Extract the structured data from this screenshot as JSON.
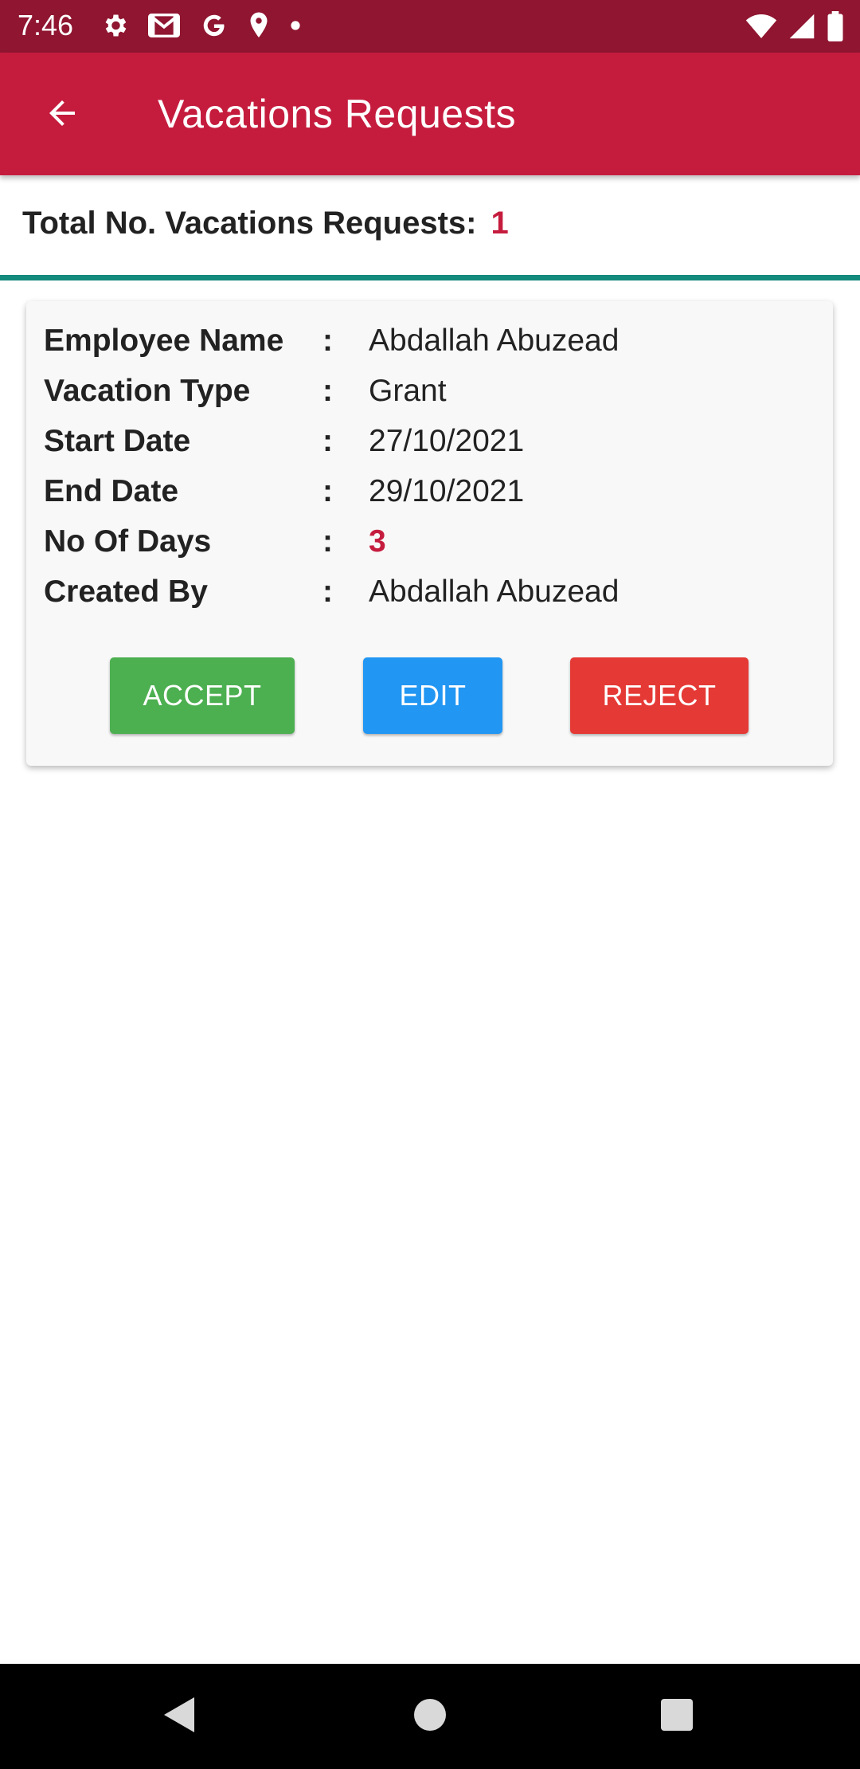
{
  "status_bar": {
    "time": "7:46",
    "icons_left": [
      "settings-icon",
      "gmail-icon",
      "google-icon",
      "location-icon",
      "dot-icon"
    ],
    "icons_right": [
      "wifi-icon",
      "signal-icon",
      "battery-icon"
    ]
  },
  "app_bar": {
    "title": "Vacations Requests",
    "back_icon": "arrow-back-icon",
    "color": "#c51c3e"
  },
  "summary": {
    "label": "Total No. Vacations Requests:",
    "count": "1"
  },
  "requests": [
    {
      "fields": [
        {
          "label": "Employee Name",
          "colon": ":",
          "value": "Abdallah Abuzead"
        },
        {
          "label": "Vacation Type",
          "colon": ":",
          "value": "Grant"
        },
        {
          "label": "Start Date",
          "colon": ":",
          "value": "27/10/2021"
        },
        {
          "label": "End Date",
          "colon": ":",
          "value": "29/10/2021"
        },
        {
          "label": "No Of Days",
          "colon": ":",
          "value": "3"
        },
        {
          "label": "Created By",
          "colon": ":",
          "value": "Abdallah Abuzead"
        }
      ],
      "actions": {
        "accept_label": "ACCEPT",
        "edit_label": "EDIT",
        "reject_label": "REJECT"
      }
    }
  ],
  "colors": {
    "status_bar": "#8f1530",
    "accent": "#c51c3e",
    "divider": "#138a7c",
    "accept": "#4caf50",
    "edit": "#2196f3",
    "reject": "#e53935"
  },
  "nav_bar": {
    "icons": [
      "back-triangle-icon",
      "home-circle-icon",
      "recents-square-icon"
    ]
  }
}
